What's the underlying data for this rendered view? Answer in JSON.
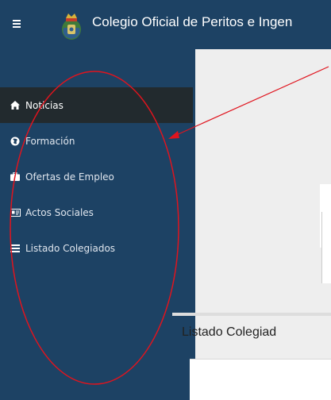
{
  "header": {
    "title": "Colegio Oficial de Peritos e Ingen",
    "menu_icon": "hamburger-icon",
    "logo": "college-crest-logo"
  },
  "sidebar": {
    "items": [
      {
        "label": "Noticias",
        "icon": "home-icon",
        "active": true
      },
      {
        "label": "Formación",
        "icon": "globe-icon",
        "active": false
      },
      {
        "label": "Ofertas de Empleo",
        "icon": "briefcase-icon",
        "active": false
      },
      {
        "label": "Actos Sociales",
        "icon": "id-card-icon",
        "active": false
      },
      {
        "label": "Listado Colegiados",
        "icon": "list-icon",
        "active": false
      }
    ]
  },
  "main": {
    "section_title": "Listado Colegiad"
  },
  "colors": {
    "sidebar_bg": "#1d4264",
    "active_item_bg": "#222a2e",
    "content_bg": "#eeeeee",
    "annotation": "#e0141e"
  }
}
